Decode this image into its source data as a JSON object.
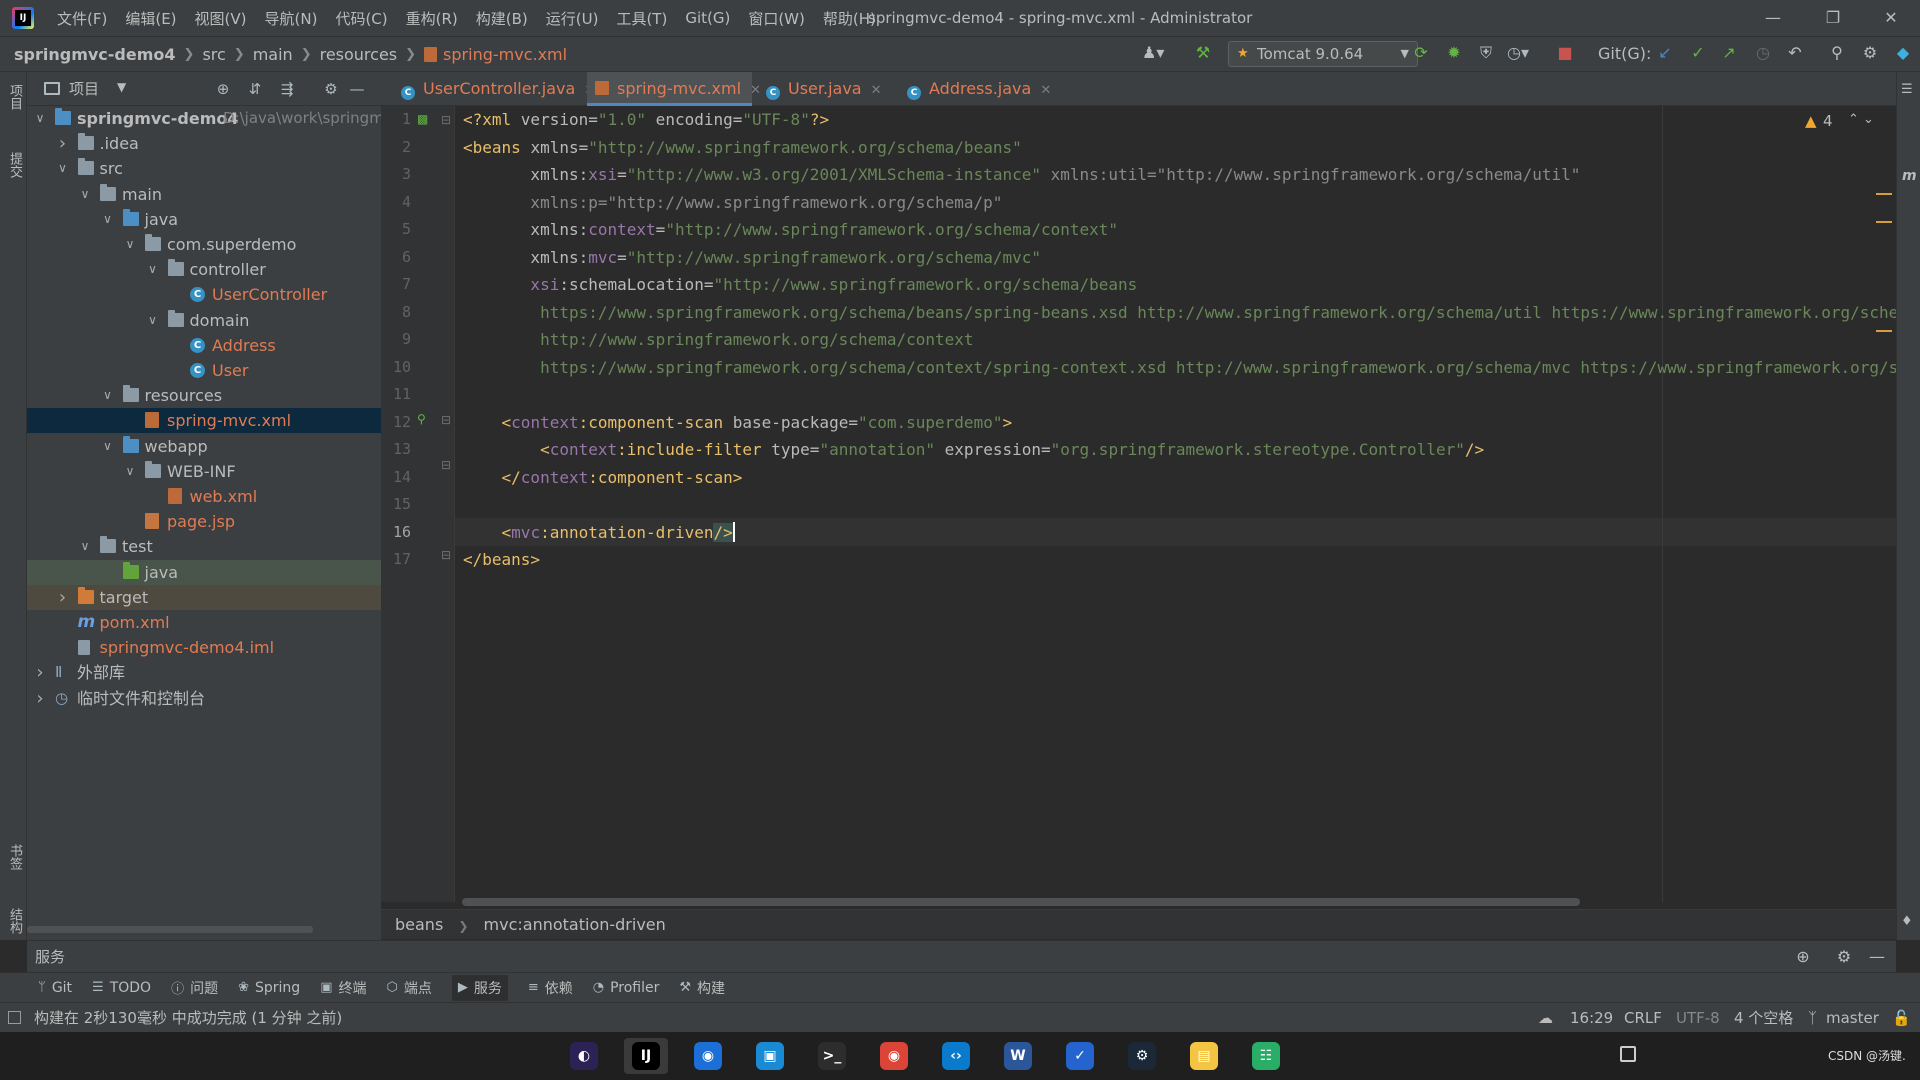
{
  "menubar": {
    "items": [
      "文件(F)",
      "编辑(E)",
      "视图(V)",
      "导航(N)",
      "代码(C)",
      "重构(R)",
      "构建(B)",
      "运行(U)",
      "工具(T)",
      "Git(G)",
      "窗口(W)",
      "帮助(H)"
    ],
    "window_title": "springmvc-demo4 - spring-mvc.xml - Administrator"
  },
  "navbar": {
    "crumbs": [
      "springmvc-demo4",
      "src",
      "main",
      "resources",
      "spring-mvc.xml"
    ],
    "run_config": "Tomcat 9.0.64",
    "git_label": "Git(G):"
  },
  "left_stripe": {
    "top_labels": [
      "项目",
      "提交"
    ],
    "bottom_labels": [
      "书签",
      "结构"
    ]
  },
  "project": {
    "title": "项目",
    "tree": [
      {
        "label": "springmvc-demo4",
        "path": "D:\\java\\work\\springm",
        "depth": 0,
        "arrow": "down",
        "icon": "module",
        "style": "bold"
      },
      {
        "label": ".idea",
        "depth": 1,
        "arrow": "right",
        "icon": "folder"
      },
      {
        "label": "src",
        "depth": 1,
        "arrow": "down",
        "icon": "folder"
      },
      {
        "label": "main",
        "depth": 2,
        "arrow": "down",
        "icon": "folder"
      },
      {
        "label": "java",
        "depth": 3,
        "arrow": "down",
        "icon": "folder-blue"
      },
      {
        "label": "com.superdemo",
        "depth": 4,
        "arrow": "down",
        "icon": "package"
      },
      {
        "label": "controller",
        "depth": 5,
        "arrow": "down",
        "icon": "package"
      },
      {
        "label": "UserController",
        "depth": 6,
        "arrow": "",
        "icon": "class",
        "style": "orange"
      },
      {
        "label": "domain",
        "depth": 5,
        "arrow": "down",
        "icon": "package"
      },
      {
        "label": "Address",
        "depth": 6,
        "arrow": "",
        "icon": "class",
        "style": "orange"
      },
      {
        "label": "User",
        "depth": 6,
        "arrow": "",
        "icon": "class",
        "style": "orange"
      },
      {
        "label": "resources",
        "depth": 3,
        "arrow": "down",
        "icon": "folder-res"
      },
      {
        "label": "spring-mvc.xml",
        "depth": 4,
        "arrow": "",
        "icon": "xml",
        "style": "orange",
        "selected": true
      },
      {
        "label": "webapp",
        "depth": 3,
        "arrow": "down",
        "icon": "folder-blue"
      },
      {
        "label": "WEB-INF",
        "depth": 4,
        "arrow": "down",
        "icon": "folder"
      },
      {
        "label": "web.xml",
        "depth": 5,
        "arrow": "",
        "icon": "xml",
        "style": "orange"
      },
      {
        "label": "page.jsp",
        "depth": 4,
        "arrow": "",
        "icon": "jsp",
        "style": "orange"
      },
      {
        "label": "test",
        "depth": 2,
        "arrow": "down",
        "icon": "folder"
      },
      {
        "label": "java",
        "depth": 3,
        "arrow": "",
        "icon": "folder-green",
        "bg": "test"
      },
      {
        "label": "target",
        "depth": 1,
        "arrow": "right",
        "icon": "folder-orange",
        "bg": "target"
      },
      {
        "label": "pom.xml",
        "depth": 1,
        "arrow": "",
        "icon": "maven",
        "style": "orange"
      },
      {
        "label": "springmvc-demo4.iml",
        "depth": 1,
        "arrow": "",
        "icon": "iml",
        "style": "orange"
      },
      {
        "label": "外部库",
        "depth": 0,
        "arrow": "right",
        "icon": "library"
      },
      {
        "label": "临时文件和控制台",
        "depth": 0,
        "arrow": "right",
        "icon": "scratch"
      }
    ]
  },
  "tabs": [
    {
      "label": "UserController.java",
      "icon": "class",
      "active": false
    },
    {
      "label": "spring-mvc.xml",
      "icon": "xml",
      "active": true
    },
    {
      "label": "User.java",
      "icon": "class",
      "active": false
    },
    {
      "label": "Address.java",
      "icon": "class",
      "active": false
    }
  ],
  "editor": {
    "warning_count": "4",
    "lines": [
      [
        [
          "t-tag",
          "<?xml "
        ],
        [
          "t-attr",
          "version"
        ],
        [
          "t-attr",
          "="
        ],
        [
          "t-val",
          "\"1.0\""
        ],
        [
          "t-attr",
          " encoding"
        ],
        [
          "t-attr",
          "="
        ],
        [
          "t-val",
          "\"UTF-8\""
        ],
        [
          "t-tag",
          "?>"
        ]
      ],
      [
        [
          "t-tag",
          "<beans "
        ],
        [
          "t-attr",
          "xmlns"
        ],
        [
          "t-attr",
          "="
        ],
        [
          "t-val",
          "\"http://www.springframework.org/schema/beans\""
        ]
      ],
      [
        [
          "t-attr",
          "       xmlns:"
        ],
        [
          "t-ns",
          "xsi"
        ],
        [
          "t-attr",
          "="
        ],
        [
          "t-val",
          "\"http://www.w3.org/2001/XMLSchema-instance\""
        ],
        [
          "t-dim",
          " xmlns:util=\"http://www.springframework.org/schema/util\""
        ]
      ],
      [
        [
          "t-dim",
          "       xmlns:p=\"http://www.springframework.org/schema/p\""
        ]
      ],
      [
        [
          "t-attr",
          "       xmlns:"
        ],
        [
          "t-ns",
          "context"
        ],
        [
          "t-attr",
          "="
        ],
        [
          "t-val",
          "\"http://www.springframework.org/schema/context\""
        ]
      ],
      [
        [
          "t-attr",
          "       xmlns:"
        ],
        [
          "t-ns",
          "mvc"
        ],
        [
          "t-attr",
          "="
        ],
        [
          "t-val",
          "\"http://www.springframework.org/schema/mvc\""
        ]
      ],
      [
        [
          "t-ns",
          "       xsi"
        ],
        [
          "t-attr",
          ":schemaLocation="
        ],
        [
          "t-val",
          "\"http://www.springframework.org/schema/beans"
        ]
      ],
      [
        [
          "t-val",
          "        https://www.springframework.org/schema/beans/spring-beans.xsd http://www.springframework.org/schema/util https://www.springframework.org/schema/util/spring-util.xsd"
        ]
      ],
      [
        [
          "t-val",
          "        http://www.springframework.org/schema/context"
        ]
      ],
      [
        [
          "t-val",
          "        https://www.springframework.org/schema/context/spring-context.xsd http://www.springframework.org/schema/mvc https://www.springframework.org/schema/mvc/spring-mvc.xsd\""
        ],
        [
          "t-tag",
          ">"
        ]
      ],
      [],
      [
        [
          "t-tag",
          "    <"
        ],
        [
          "t-ns",
          "context"
        ],
        [
          "t-tag",
          ":component-scan "
        ],
        [
          "t-attr",
          "base-package"
        ],
        [
          "t-attr",
          "="
        ],
        [
          "t-val",
          "\"com.superdemo\""
        ],
        [
          "t-tag",
          ">"
        ]
      ],
      [
        [
          "t-tag",
          "        <"
        ],
        [
          "t-ns",
          "context"
        ],
        [
          "t-tag",
          ":include-filter "
        ],
        [
          "t-attr",
          "type"
        ],
        [
          "t-attr",
          "="
        ],
        [
          "t-val",
          "\"annotation\""
        ],
        [
          "t-attr",
          " expression"
        ],
        [
          "t-attr",
          "="
        ],
        [
          "t-val",
          "\"org.springframework.stereotype.Controller\""
        ],
        [
          "t-tag",
          "/>"
        ]
      ],
      [
        [
          "t-tag",
          "    </"
        ],
        [
          "t-ns",
          "context"
        ],
        [
          "t-tag",
          ":component-scan>"
        ]
      ],
      [],
      [
        [
          "t-tag",
          "    <"
        ],
        [
          "t-ns",
          "mvc"
        ],
        [
          "t-tag",
          ":annotation-driven"
        ],
        [
          "t-tag",
          "/>"
        ]
      ],
      [
        [
          "t-tag",
          "</beans>"
        ]
      ]
    ]
  },
  "editor_crumbs": [
    "beans",
    "mvc:annotation-driven"
  ],
  "services": {
    "title": "服务"
  },
  "tool_tabs": [
    {
      "label": "Git",
      "icon": "git-icon",
      "active": false
    },
    {
      "label": "TODO",
      "icon": "todo-icon",
      "active": false
    },
    {
      "label": "问题",
      "icon": "problems-icon",
      "active": false
    },
    {
      "label": "Spring",
      "icon": "spring-icon",
      "active": false
    },
    {
      "label": "终端",
      "icon": "terminal-icon",
      "active": false
    },
    {
      "label": "端点",
      "icon": "endpoints-icon",
      "active": false
    },
    {
      "label": "服务",
      "icon": "services-icon",
      "active": true
    },
    {
      "label": "依赖",
      "icon": "dependencies-icon",
      "active": false
    },
    {
      "label": "Profiler",
      "icon": "profiler-icon",
      "active": false
    },
    {
      "label": "构建",
      "icon": "build-icon",
      "active": false
    }
  ],
  "status": {
    "message": "构建在 2秒130毫秒 中成功完成 (1 分钟 之前)",
    "position": "16:29",
    "line_sep": "CRLF",
    "encoding": "UTF-8",
    "indent": "4 个空格",
    "branch": "master"
  },
  "taskbar": {
    "apps": [
      "eclipse",
      "intellij",
      "browser-2",
      "box-app",
      "terminal",
      "chrome",
      "vscode",
      "word",
      "todo",
      "steam",
      "explorer",
      "wechat"
    ],
    "corner_text": "CSDN @汤键."
  }
}
